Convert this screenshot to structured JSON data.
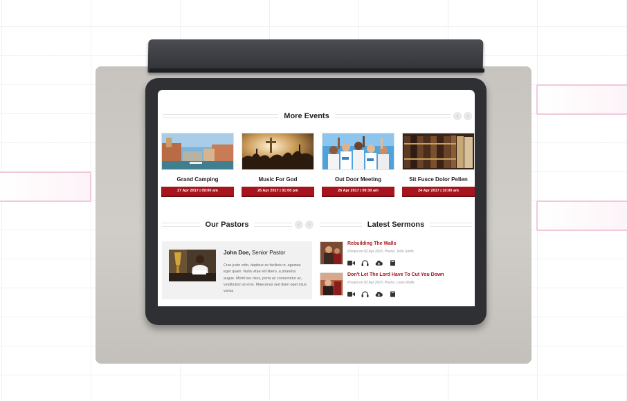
{
  "more_events": {
    "title": "More Events",
    "events": [
      {
        "title": "Grand Camping",
        "date": "27 Apr 2017 | 09:00 am",
        "image_icon": "venice-canal-photo"
      },
      {
        "title": "Music For God",
        "date": "26 Apr 2017 | 01:00 pm",
        "image_icon": "worship-silhouette-photo"
      },
      {
        "title": "Out Door Meeting",
        "date": "26 Apr 2017 | 09:30 am",
        "image_icon": "group-celebration-photo"
      },
      {
        "title": "Sit Fusce Dolor Pellen",
        "date": "24 Apr 2017 | 10:00 am",
        "image_icon": "bookshelf-photo"
      }
    ]
  },
  "our_pastors": {
    "title": "Our Pastors",
    "pastor": {
      "name": "John Doe,",
      "role": "Senior Pastor",
      "bio": "Cras justo odio, dapibus ac facilisis in, egestas eget quam. Nulla vitae elit libero, a pharetra augue. Morbi leo risus, porta ac consectetur ac, vestibulum at eros. Maecenas sed diam eget risus varius"
    }
  },
  "latest_sermons": {
    "title": "Latest Sermons",
    "items": [
      {
        "title": "Rebuilding The Walls",
        "meta": "Posted on 02 Apr 2015, Pastor, John Smith"
      },
      {
        "title": "Don't Let The Lord Have To Cut You Down",
        "meta": "Posted on 02 Apr 2015, Pastor, Louis Walle"
      }
    ],
    "actions": [
      "video-icon",
      "headphones-icon",
      "download-cloud-icon",
      "book-icon"
    ]
  },
  "colors": {
    "accent": "#a8141d",
    "tablet": "#2e3034"
  }
}
